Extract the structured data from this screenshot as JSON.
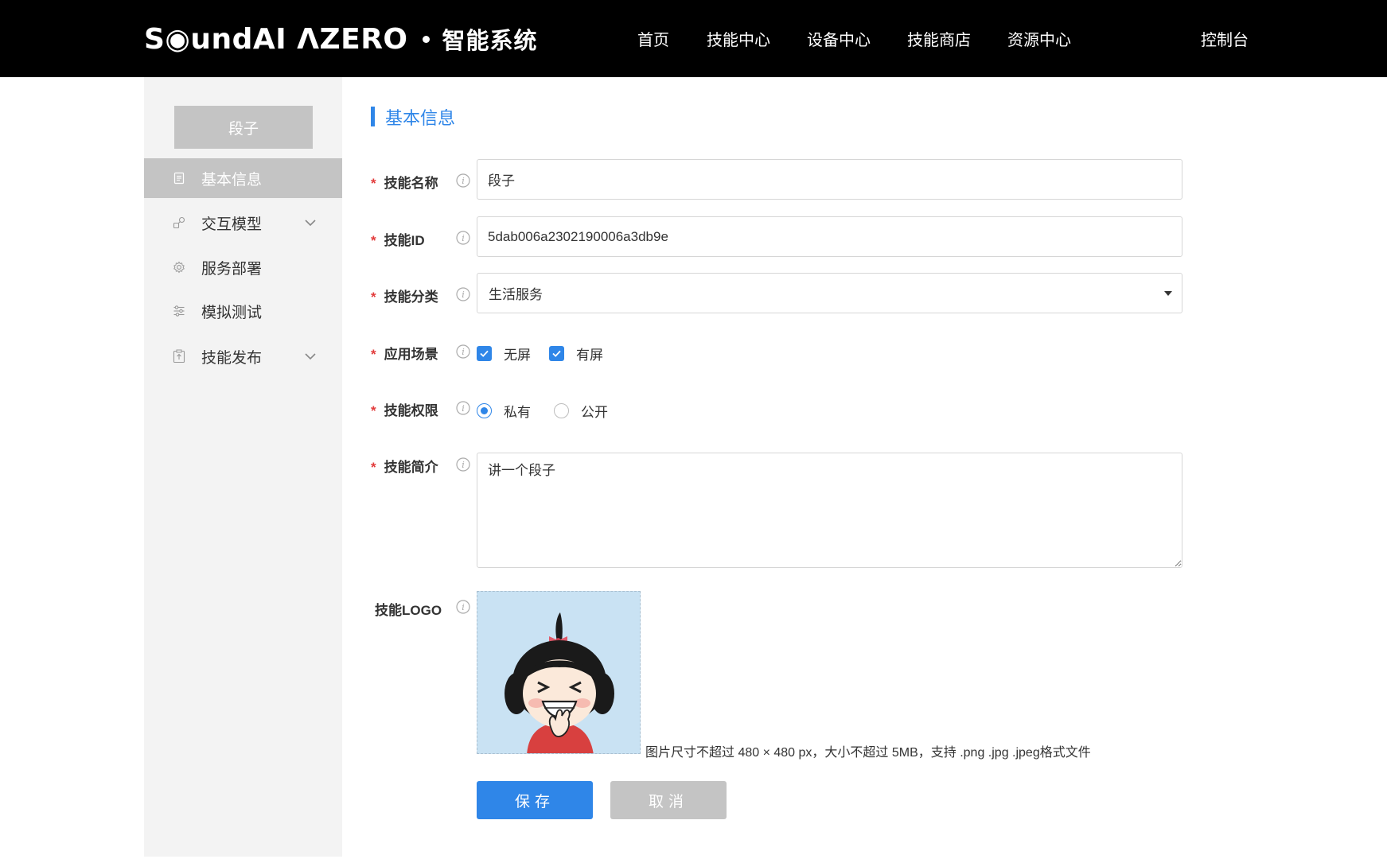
{
  "header": {
    "logo_text": "S◉undAI ΛZERO",
    "subtitle": "智能系统",
    "nav": [
      "首页",
      "技能中心",
      "设备中心",
      "技能商店",
      "资源中心"
    ],
    "console": "控制台"
  },
  "sidebar": {
    "skill_name": "段子",
    "items": [
      {
        "label": "基本信息",
        "icon": "document-icon",
        "active": true,
        "expandable": false
      },
      {
        "label": "交互模型",
        "icon": "interaction-model-icon",
        "active": false,
        "expandable": true
      },
      {
        "label": "服务部署",
        "icon": "gear-icon",
        "active": false,
        "expandable": false
      },
      {
        "label": "模拟测试",
        "icon": "sliders-icon",
        "active": false,
        "expandable": false
      },
      {
        "label": "技能发布",
        "icon": "clipboard-upload-icon",
        "active": false,
        "expandable": true
      }
    ]
  },
  "form": {
    "section_title": "基本信息",
    "required_mark": "*",
    "name": {
      "label": "技能名称",
      "value": "段子"
    },
    "id": {
      "label": "技能ID",
      "value": "5dab006a2302190006a3db9e"
    },
    "category": {
      "label": "技能分类",
      "value": "生活服务"
    },
    "scenario": {
      "label": "应用场景",
      "options": [
        {
          "label": "无屏",
          "checked": true
        },
        {
          "label": "有屏",
          "checked": true
        }
      ]
    },
    "permission": {
      "label": "技能权限",
      "options": [
        {
          "label": "私有",
          "selected": true
        },
        {
          "label": "公开",
          "selected": false
        }
      ]
    },
    "intro": {
      "label": "技能简介",
      "value": "讲一个段子"
    },
    "logo": {
      "label": "技能LOGO",
      "hint": "图片尺寸不超过 480 × 480 px，大小不超过 5MB，支持 .png .jpg .jpeg格式文件"
    },
    "save_label": "保存",
    "cancel_label": "取消"
  },
  "colors": {
    "accent": "#2f86e8",
    "required": "#e23b3b",
    "sidebar_active": "#c4c4c4",
    "topbar": "#000000"
  }
}
